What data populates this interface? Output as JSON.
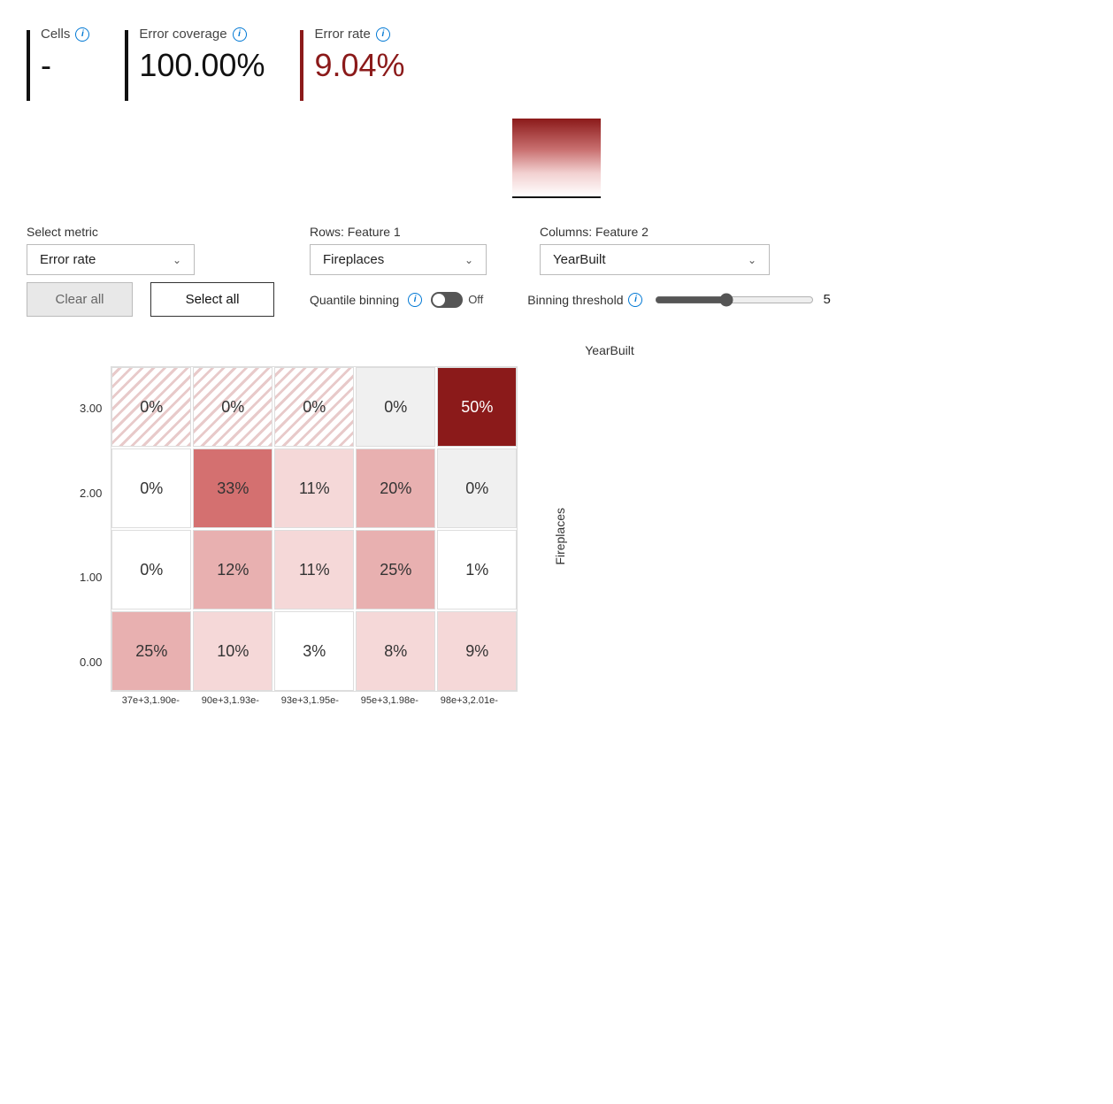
{
  "metrics": {
    "cells": {
      "label": "Cells",
      "value": "-"
    },
    "error_coverage": {
      "label": "Error coverage",
      "value": "100.00%"
    },
    "error_rate": {
      "label": "Error rate",
      "value": "9.04%"
    }
  },
  "controls": {
    "select_metric_label": "Select metric",
    "metric_value": "Error rate",
    "rows_label": "Rows: Feature 1",
    "rows_value": "Fireplaces",
    "cols_label": "Columns: Feature 2",
    "cols_value": "YearBuilt",
    "clear_all_label": "Clear all",
    "select_all_label": "Select all",
    "quantile_binning_label": "Quantile binning",
    "quantile_binning_state": "Off",
    "binning_threshold_label": "Binning threshold",
    "binning_threshold_value": "5"
  },
  "matrix": {
    "x_title": "YearBuilt",
    "y_title": "Fireplaces",
    "x_labels": [
      "37e+3,1.90e-",
      "90e+3,1.93e-",
      "93e+3,1.95e-",
      "95e+3,1.98e-",
      "98e+3,2.01e-"
    ],
    "y_labels": [
      "3.00",
      "2.00",
      "1.00",
      "0.00"
    ],
    "cells": [
      [
        "0%",
        "0%",
        "0%",
        "0%",
        "50%"
      ],
      [
        "0%",
        "33%",
        "11%",
        "20%",
        "0%"
      ],
      [
        "0%",
        "12%",
        "11%",
        "25%",
        "1%"
      ],
      [
        "25%",
        "10%",
        "3%",
        "8%",
        "9%"
      ]
    ],
    "cell_styles": [
      [
        "hatched c-white",
        "hatched c-white",
        "hatched c-white",
        "c-gray",
        "c-dark"
      ],
      [
        "c-white",
        "c-medium",
        "c-light",
        "c-medium-light",
        "c-gray"
      ],
      [
        "c-white",
        "c-medium-light",
        "c-light",
        "c-medium-light",
        "c-white"
      ],
      [
        "c-medium-light",
        "c-light",
        "c-white",
        "c-light",
        "c-light"
      ]
    ]
  }
}
